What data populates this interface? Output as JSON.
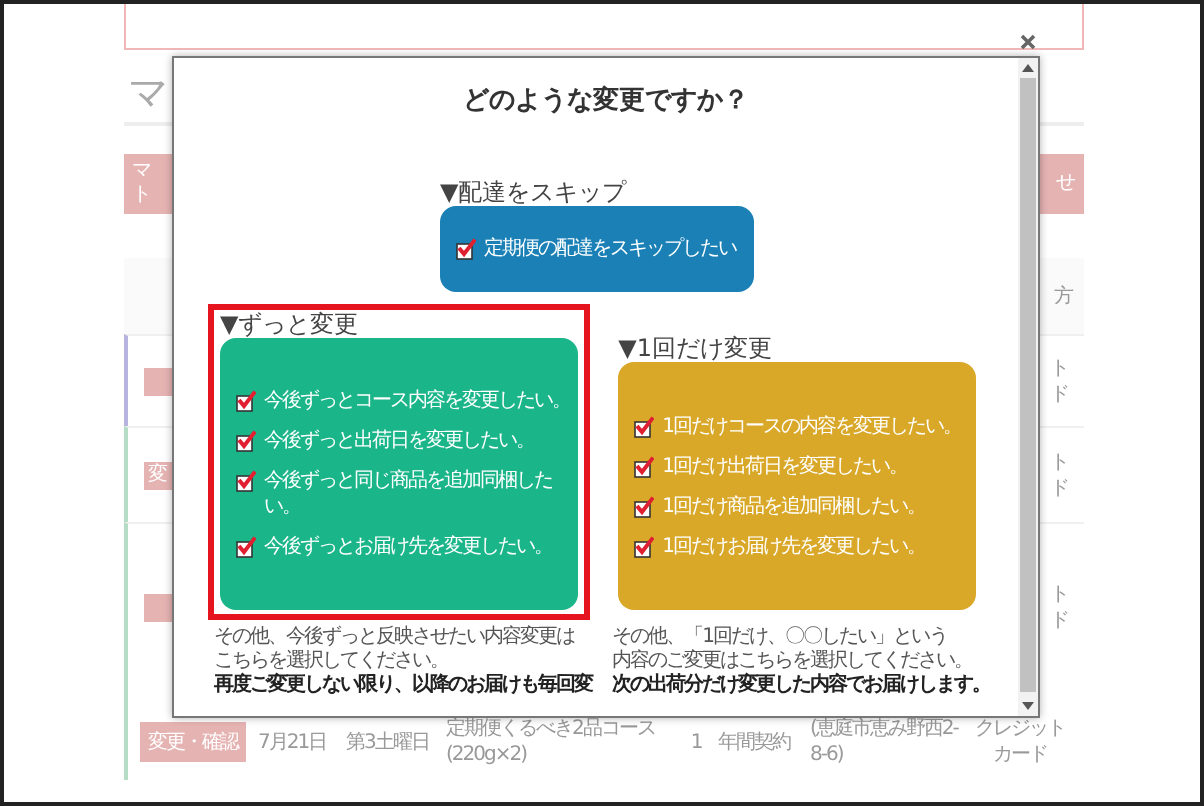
{
  "background": {
    "title": "マ",
    "nav_buttons": [
      {
        "lines": [
          "マ",
          "ト"
        ]
      },
      {
        "lines": [
          "せ"
        ]
      }
    ],
    "header_fragment": "方",
    "partial_rows": [
      {
        "payment_fragment": [
          "ト",
          "ド"
        ]
      },
      {
        "button_fragment": "変",
        "payment_fragment": [
          "ト",
          "ド"
        ]
      },
      {
        "payment_fragment": [
          "ト",
          "ド"
        ]
      }
    ],
    "last_row": {
      "button": "変更・確認",
      "date": "7月21日",
      "weekday": "第3土曜日",
      "course": [
        "定期便くるべき2品コース",
        "(220g×2)"
      ],
      "quantity": "1",
      "contract": "年間契約",
      "address": [
        "(恵庭市恵み野西2-",
        "8-6)"
      ],
      "payment": [
        "クレジット",
        "カード"
      ]
    }
  },
  "modal": {
    "title": "どのような変更ですか？",
    "skip": {
      "heading": "▼配達をスキップ",
      "options": [
        {
          "label": "定期便の配達をスキップしたい",
          "checked": true
        }
      ]
    },
    "sections": [
      {
        "heading": "▼ずっと変更",
        "highlighted": true,
        "color": "#1bb58a",
        "options": [
          {
            "label": "今後ずっとコース内容を変更したい。",
            "checked": true
          },
          {
            "label": "今後ずっと出荷日を変更したい。",
            "checked": true
          },
          {
            "label": "今後ずっと同じ商品を追加同梱したい。",
            "checked": true
          },
          {
            "label": "今後ずっとお届け先を変更したい。",
            "checked": true
          }
        ],
        "notes": [
          {
            "text": "その他、今後ずっと反映させたい内容変更は",
            "bold": false
          },
          {
            "text": "こちらを選択してください。",
            "bold": false
          },
          {
            "text": "再度ご変更しない限り、以降のお届けも毎回変",
            "bold": true
          }
        ]
      },
      {
        "heading": "▼1回だけ変更",
        "highlighted": false,
        "color": "#d9a829",
        "options": [
          {
            "label": "1回だけコースの内容を変更したい。",
            "checked": true
          },
          {
            "label": "1回だけ出荷日を変更したい。",
            "checked": true
          },
          {
            "label": "1回だけ商品を追加同梱したい。",
            "checked": true
          },
          {
            "label": "1回だけお届け先を変更したい。",
            "checked": true
          }
        ],
        "notes": [
          {
            "text": "その他、「1回だけ、〇〇したい」という",
            "bold": false
          },
          {
            "text": "内容のご変更はこちらを選択してください。",
            "bold": false
          },
          {
            "text": "次の出荷分だけ変更した内容でお届けします。",
            "bold": true
          }
        ]
      }
    ]
  }
}
